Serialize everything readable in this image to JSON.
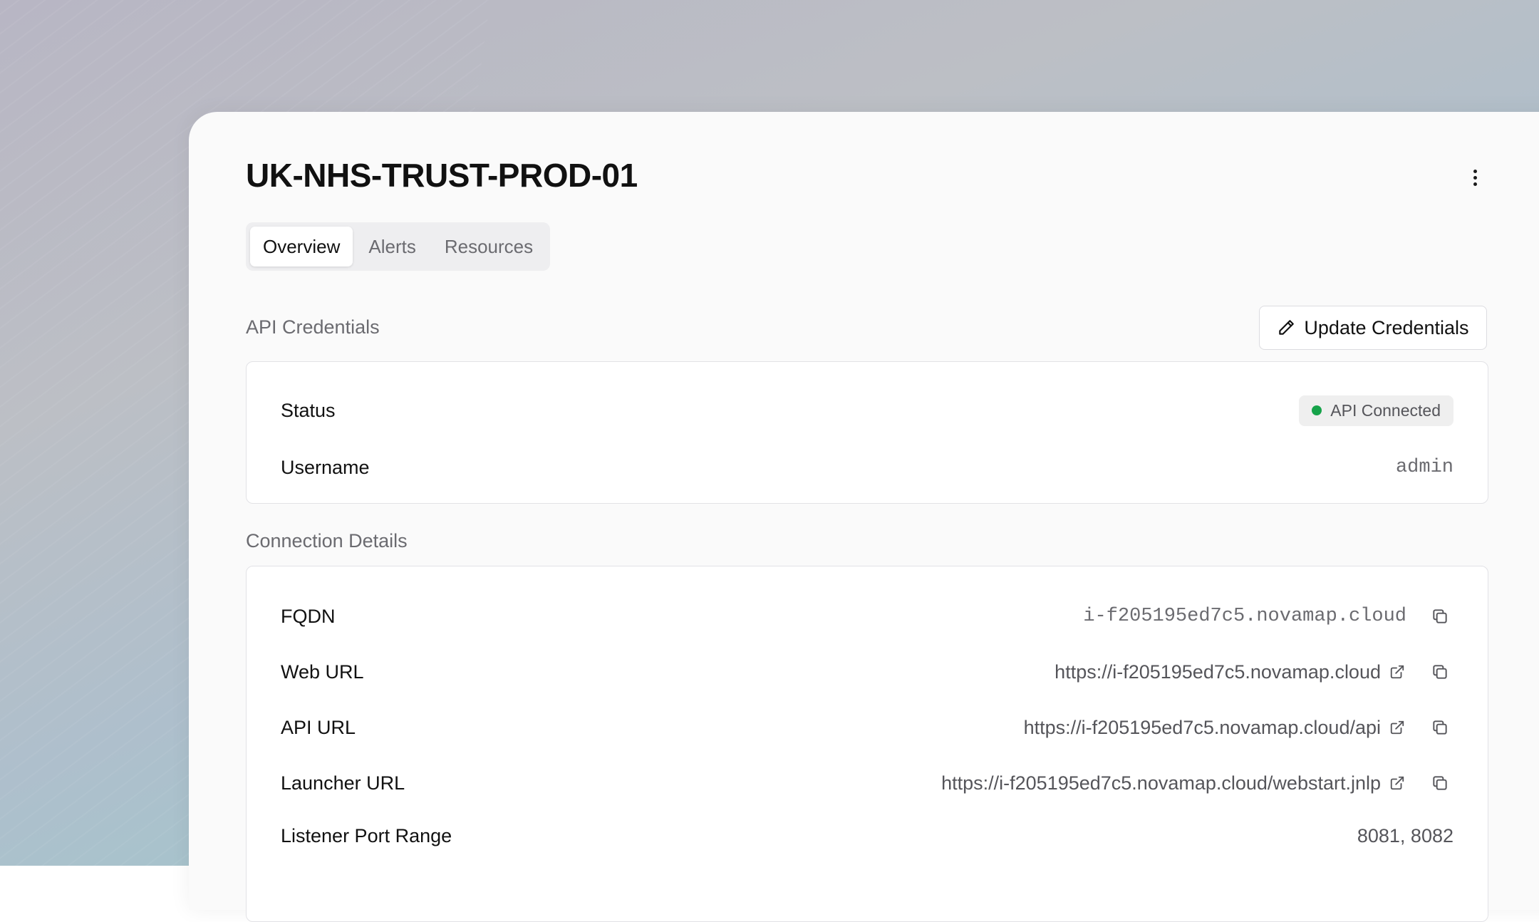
{
  "page": {
    "title": "UK-NHS-TRUST-PROD-01"
  },
  "tabs": [
    {
      "label": "Overview",
      "active": true
    },
    {
      "label": "Alerts",
      "active": false
    },
    {
      "label": "Resources",
      "active": false
    }
  ],
  "api_credentials": {
    "section_label": "API Credentials",
    "update_button_label": "Update Credentials",
    "rows": {
      "status": {
        "label": "Status",
        "value": "API Connected",
        "status_color": "#16a34a"
      },
      "username": {
        "label": "Username",
        "value": "admin"
      }
    }
  },
  "connection_details": {
    "section_label": "Connection Details",
    "rows": {
      "fqdn": {
        "label": "FQDN",
        "value": "i-f205195ed7c5.novamap.cloud"
      },
      "web_url": {
        "label": "Web URL",
        "value": "https://i-f205195ed7c5.novamap.cloud"
      },
      "api_url": {
        "label": "API URL",
        "value": "https://i-f205195ed7c5.novamap.cloud/api"
      },
      "launcher_url": {
        "label": "Launcher URL",
        "value": "https://i-f205195ed7c5.novamap.cloud/webstart.jnlp"
      },
      "listener_port_range": {
        "label": "Listener Port Range",
        "value": "8081, 8082"
      }
    }
  },
  "icons": {
    "menu": "more-vertical-icon",
    "edit": "pencil-icon",
    "copy": "copy-icon",
    "external": "external-link-icon"
  }
}
